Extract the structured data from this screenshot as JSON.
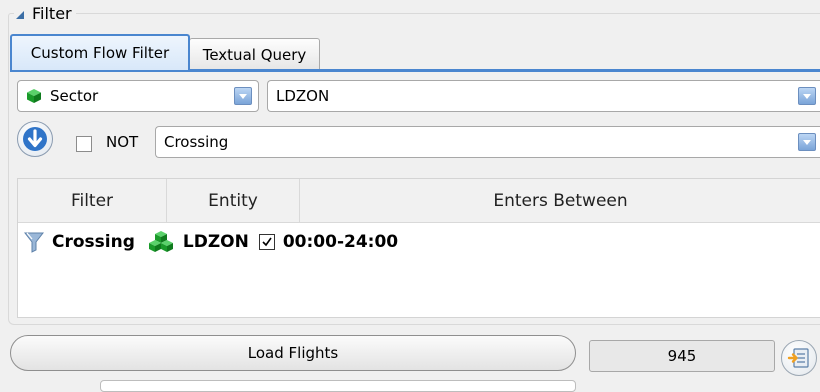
{
  "filter_group": {
    "title": "Filter"
  },
  "tabs": [
    {
      "label": "Custom Flow Filter",
      "active": true
    },
    {
      "label": "Textual Query",
      "active": false
    }
  ],
  "entity_type": {
    "value": "Sector",
    "icon": "green-cube-icon"
  },
  "entity_name": {
    "value": "LDZON"
  },
  "condition": {
    "not_label": "NOT",
    "not_checked": false,
    "value": "Crossing"
  },
  "table": {
    "columns": [
      "Filter",
      "Entity",
      "Enters Between"
    ],
    "rows": [
      {
        "filter": "Crossing",
        "entity": "LDZON",
        "checked": true,
        "time": "00:00-24:00"
      }
    ]
  },
  "actions": {
    "load_label": "Load Flights",
    "count": "945"
  },
  "colors": {
    "accent": "#4a86cf",
    "cube_green": "#1fa12e"
  }
}
